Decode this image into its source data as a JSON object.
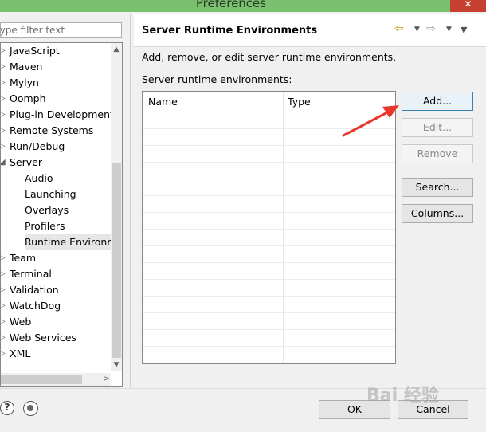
{
  "window": {
    "title": "Preferences",
    "close_glyph": "✕"
  },
  "sidebar": {
    "filter_placeholder": "type filter text",
    "items": [
      {
        "label": "JavaScript",
        "expanded": false,
        "child": false
      },
      {
        "label": "Maven",
        "expanded": false,
        "child": false
      },
      {
        "label": "Mylyn",
        "expanded": false,
        "child": false
      },
      {
        "label": "Oomph",
        "expanded": false,
        "child": false
      },
      {
        "label": "Plug-in Development",
        "expanded": false,
        "child": false
      },
      {
        "label": "Remote Systems",
        "expanded": false,
        "child": false
      },
      {
        "label": "Run/Debug",
        "expanded": false,
        "child": false
      },
      {
        "label": "Server",
        "expanded": true,
        "child": false
      },
      {
        "label": "Audio",
        "child": true
      },
      {
        "label": "Launching",
        "child": true
      },
      {
        "label": "Overlays",
        "child": true
      },
      {
        "label": "Profilers",
        "child": true
      },
      {
        "label": "Runtime Environm",
        "child": true,
        "selected": true
      },
      {
        "label": "Team",
        "expanded": false,
        "child": false
      },
      {
        "label": "Terminal",
        "expanded": false,
        "child": false
      },
      {
        "label": "Validation",
        "expanded": false,
        "child": false
      },
      {
        "label": "WatchDog",
        "expanded": false,
        "child": false
      },
      {
        "label": "Web",
        "expanded": false,
        "child": false
      },
      {
        "label": "Web Services",
        "expanded": false,
        "child": false
      },
      {
        "label": "XML",
        "expanded": false,
        "child": false
      }
    ]
  },
  "page": {
    "title": "Server Runtime Environments",
    "description": "Add, remove, or edit server runtime environments.",
    "list_label": "Server runtime environments:",
    "columns": [
      "Name",
      "Type"
    ],
    "rows": []
  },
  "buttons": {
    "add": "Add...",
    "edit": "Edit...",
    "remove": "Remove",
    "search": "Search...",
    "columns": "Columns..."
  },
  "footer": {
    "ok": "OK",
    "cancel": "Cancel",
    "help_glyph": "?"
  },
  "watermark": "Bai 经验",
  "colors": {
    "titlebar": "#79c16e",
    "close": "#c7402f",
    "annotation_arrow": "#e8382b"
  },
  "icons": [
    "back-arrow-icon",
    "forward-arrow-icon",
    "menu-dropdown-icon",
    "help-icon",
    "preferences-link-icon"
  ]
}
